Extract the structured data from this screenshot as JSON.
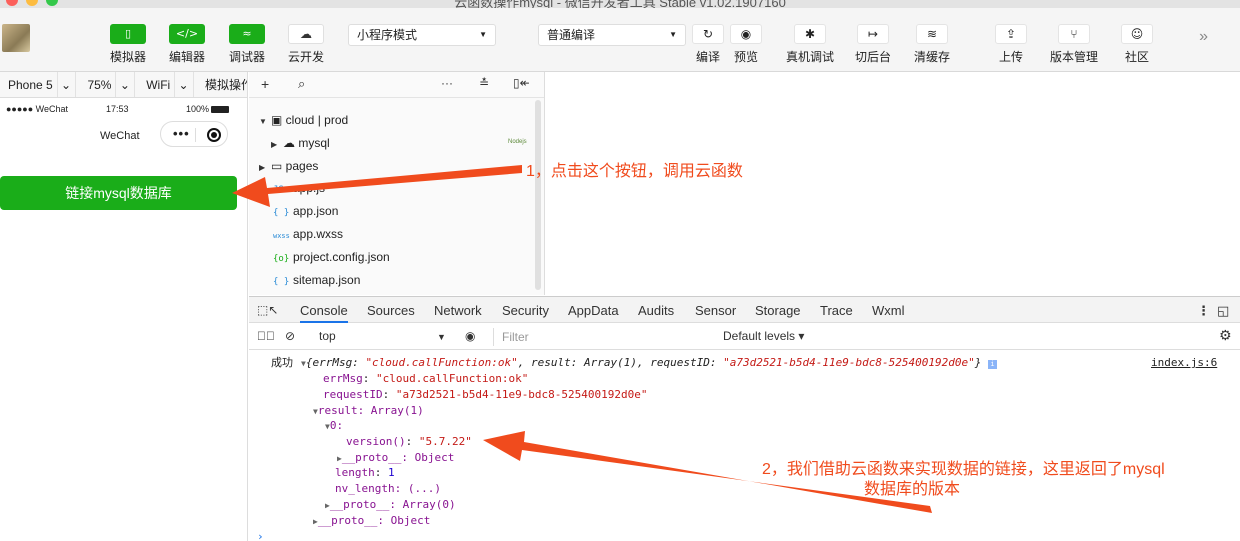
{
  "window": {
    "title": "云函数操作mysql - 微信开发者工具 Stable v1.02.1907160"
  },
  "toolbar": {
    "simulator": "模拟器",
    "editor": "编辑器",
    "debugger": "调试器",
    "cloud_dev": "云开发",
    "mode_select": "小程序模式",
    "compile_select": "普通编译",
    "compile": "编译",
    "preview": "预览",
    "real_debug": "真机调试",
    "backstage": "切后台",
    "clear_cache": "清缓存",
    "upload": "上传",
    "version_mgmt": "版本管理",
    "community": "社区"
  },
  "simulator": {
    "device": "Phone 5",
    "zoom": "75%",
    "network": "WiFi",
    "sim_ops": "模拟操作",
    "status_carrier": "●●●●● WeChat",
    "status_time": "17:53",
    "status_battery": "100%",
    "nav_title": "WeChat",
    "capsule_dots": "•••",
    "button_label": "链接mysql数据库"
  },
  "explorer": {
    "root": "cloud | prod",
    "items": [
      {
        "label": "mysql",
        "icon": "cloud-icon"
      },
      {
        "label": "pages",
        "icon": "folder-icon"
      },
      {
        "label": "app.js",
        "icon": "js-icon"
      },
      {
        "label": "app.json",
        "icon": "{ }"
      },
      {
        "label": "app.wxss",
        "icon": "wxss"
      },
      {
        "label": "project.config.json",
        "icon": "{o}"
      },
      {
        "label": "sitemap.json",
        "icon": "{ }"
      }
    ],
    "runtime_badge": "Nodejs"
  },
  "devtools": {
    "tabs": [
      "Console",
      "Sources",
      "Network",
      "Security",
      "AppData",
      "Audits",
      "Sensor",
      "Storage",
      "Trace",
      "Wxml"
    ],
    "active_tab": "Console",
    "context": "top",
    "filter_placeholder": "Filter",
    "levels": "Default levels ▾"
  },
  "console": {
    "prefix": "成功",
    "summary_open": "{errMsg: ",
    "summary_errmsg": "\"cloud.callFunction:ok\"",
    "summary_mid": ", result: Array(1), requestID: ",
    "summary_reqid": "\"a73d2521-b5d4-11e9-bdc8-525400192d0e\"",
    "summary_close": "}",
    "source": "index.js:6",
    "errmsg_key": "errMsg",
    "errmsg_val": "\"cloud.callFunction:ok\"",
    "reqid_key": "requestID",
    "reqid_val": "\"a73d2521-b5d4-11e9-bdc8-525400192d0e\"",
    "result_label": "result: Array(1)",
    "zero": "0:",
    "version_key": "version()",
    "version_val": "\"5.7.22\"",
    "proto_obj": "__proto__: Object",
    "length_key": "length",
    "length_val": "1",
    "nvlen": "nv_length: (...)",
    "proto_arr": "__proto__: Array(0)",
    "proto_obj2": "__proto__: Object"
  },
  "annotations": {
    "note1": "1，点击这个按钮，调用云函数",
    "note2_line1": "2，我们借助云函数来实现数据的链接，这里返回了mysql",
    "note2_line2": "数据库的版本",
    "arrow_color": "#f04b1d"
  }
}
